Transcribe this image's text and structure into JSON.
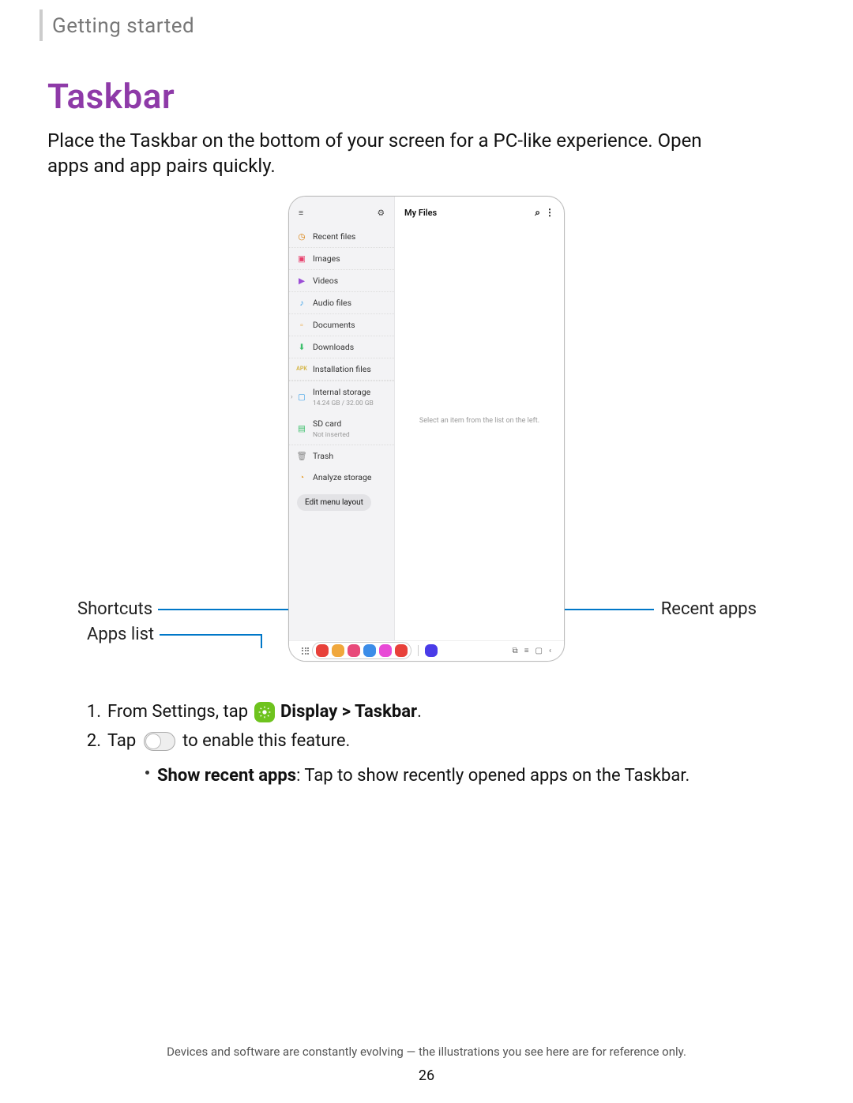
{
  "section": "Getting started",
  "title": "Taskbar",
  "intro": "Place the Taskbar on the bottom of your screen for a PC-like experience. Open apps and app pairs quickly.",
  "callouts": {
    "shortcuts": "Shortcuts",
    "apps_list": "Apps list",
    "recent_apps": "Recent apps"
  },
  "device": {
    "app_title": "My Files",
    "placeholder": "Select an item from the list on the left.",
    "sidebar": {
      "items": [
        {
          "label": "Recent files",
          "color": "#d97b00"
        },
        {
          "label": "Images",
          "color": "#e83e6b"
        },
        {
          "label": "Videos",
          "color": "#9b4dd6"
        },
        {
          "label": "Audio files",
          "color": "#3aa0e8"
        },
        {
          "label": "Documents",
          "color": "#e8a33a"
        },
        {
          "label": "Downloads",
          "color": "#3cbf6b"
        },
        {
          "label": "Installation files",
          "color": "#d6b84d"
        }
      ],
      "internal": {
        "label": "Internal storage",
        "sub": "14.24 GB / 32.00 GB"
      },
      "sdcard": {
        "label": "SD card",
        "sub": "Not inserted"
      },
      "trash": "Trash",
      "analyze": "Analyze storage",
      "edit_btn": "Edit menu layout"
    }
  },
  "steps": {
    "s1_pre": "From Settings, tap",
    "s1_bold": "Display > Taskbar",
    "s2_pre": "Tap",
    "s2_post": "to enable this feature.",
    "bullet_bold": "Show recent apps",
    "bullet_rest": ": Tap to show recently opened apps on the Taskbar."
  },
  "taskbar_colors": [
    "#e8413a",
    "#f0a73c",
    "#e84a7a",
    "#3c8de8",
    "#e84ad6",
    "#e8413a"
  ],
  "recent_color": "#4a3ce8",
  "footer": "Devices and software are constantly evolving — the illustrations you see here are for reference only.",
  "page_num": "26"
}
